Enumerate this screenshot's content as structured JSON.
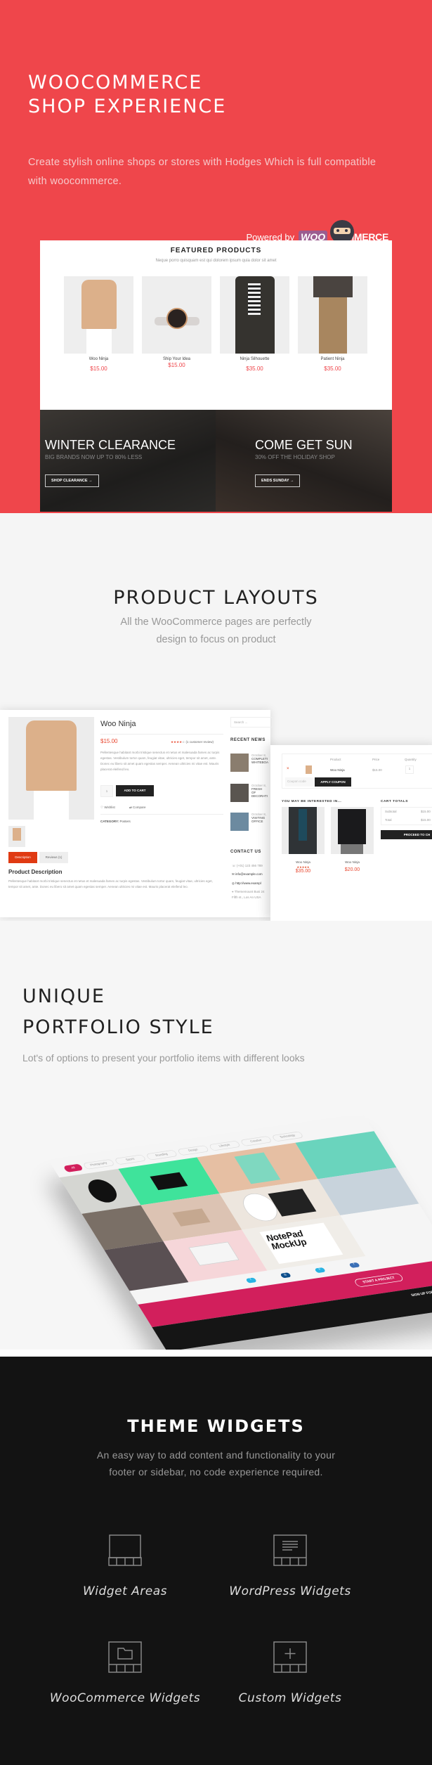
{
  "hero": {
    "title_line1": "WOOCOMMERCE",
    "title_line2": "SHOP EXPERIENCE",
    "subtitle": "Create stylish online shops or stores with Hodges Which is full compatible with woocommerce.",
    "powered_by": "Powered by",
    "logo_woo": "WOO",
    "logo_commerce": "COMMERCE",
    "accent_color": "#ef464b"
  },
  "featured": {
    "title": "FEATURED PRODUCTS",
    "subtitle": "Neque porro quisquam est qui dolorem ipsum quia dolor sit amet",
    "products": [
      {
        "name": "Woo Ninja",
        "price": "$15.00"
      },
      {
        "name": "Ship Your Idea",
        "price": "$15.00"
      },
      {
        "name": "Ninja Silhouette",
        "price": "$35.00"
      },
      {
        "name": "Patient Ninja",
        "price": "$35.00"
      }
    ],
    "banners": [
      {
        "title": "WINTER CLEARANCE",
        "subtitle": "BIG BRANDS NOW UP TO 80% LESS",
        "button": "SHOP CLEARANCE"
      },
      {
        "title": "COME GET SUN",
        "subtitle": "30% OFF THE HOLIDAY SHOP",
        "button": "ENDS SUNDAY"
      }
    ]
  },
  "layouts": {
    "title": "PRODUCT LAYOUTS",
    "subtitle_line1": "All the WooCommerce pages are perfectly",
    "subtitle_line2": "design to focus on product",
    "product_page": {
      "name": "Woo Ninja",
      "price": "$15.00",
      "rating": 4,
      "reviews": "(1 customer review)",
      "description": "Pellentesque habitant morbi tristique senectus et netus et malesuada fames ac turpis egestas. Vestibulum tortor quam, feugiat vitae, ultricies eget, tempor sit amet, ante. Donec eu libero sit amet quam egestas semper. Aenean ultricies mi vitae est. Mauris placerat eleifend leo.",
      "quantity": "1",
      "add_to_cart": "ADD TO CART",
      "wishlist": "Wishlist",
      "compare": "Compare",
      "category_label": "CATEGORY:",
      "category": "Posters",
      "tab_description": "Description",
      "tab_reviews": "Reviews (1)",
      "desc_heading": "Product Description",
      "search_placeholder": "Search ...",
      "recent_news": "RECENT NEWS",
      "news": [
        {
          "date": "October 8,",
          "title": "COMPLETI WHITEBOA"
        },
        {
          "date": "October 8,",
          "title": "FRESH OF DECORATI"
        },
        {
          "date": "October 8,",
          "title": "VISITING OFFICE"
        }
      ],
      "contact_us": "CONTACT US",
      "contacts": [
        "(+01) 123 456 789",
        "info@example.com",
        "http://www.exampl",
        "Thememount Busi 24 Fifth st., Los An USA"
      ]
    },
    "cart_page": {
      "col_product": "Product",
      "col_price": "Price",
      "col_quantity": "Quantity",
      "row_name": "Woo Ninja",
      "row_price": "$15.00",
      "row_qty": "1",
      "coupon_placeholder": "Coupon code",
      "apply_coupon": "APPLY COUPON",
      "interested": "YOU MAY BE INTERESTED IN...",
      "suggestions": [
        {
          "name": "Woo Ninja",
          "price": "$35.00",
          "rating": 5
        },
        {
          "name": "Woo Ninja",
          "price": "$20.00"
        }
      ],
      "cart_totals": "CART TOTALS",
      "subtotal_label": "Subtotal",
      "subtotal": "$15.00",
      "total_label": "Total",
      "total": "$15.00",
      "proceed": "PROCEED TO CH"
    }
  },
  "portfolio": {
    "title_line1": "UNIQUE",
    "title_line2": "PORTFOLIO STYLE",
    "subtitle": "Lot's of options to present your portfolio items with different looks",
    "filters": [
      "All",
      "Photography",
      "Sports",
      "Branding",
      "Design",
      "Lifestyle",
      "Creative",
      "Technology"
    ],
    "cta": "START A PROJECT",
    "signup": "SIGN UP FOR",
    "accent_color": "#d21f5c"
  },
  "widgets": {
    "title": "THEME WIDGETS",
    "subtitle_line1": "An easy way to add content and functionality to your",
    "subtitle_line2": "footer or sidebar, no code experience required.",
    "items": [
      {
        "label": "Widget Areas",
        "icon": "widget-areas-icon"
      },
      {
        "label": "WordPress Widgets",
        "icon": "wordpress-widgets-icon"
      },
      {
        "label": "WooCommerce Widgets",
        "icon": "woocommerce-widgets-icon"
      },
      {
        "label": "Custom Widgets",
        "icon": "custom-widgets-icon"
      }
    ]
  }
}
